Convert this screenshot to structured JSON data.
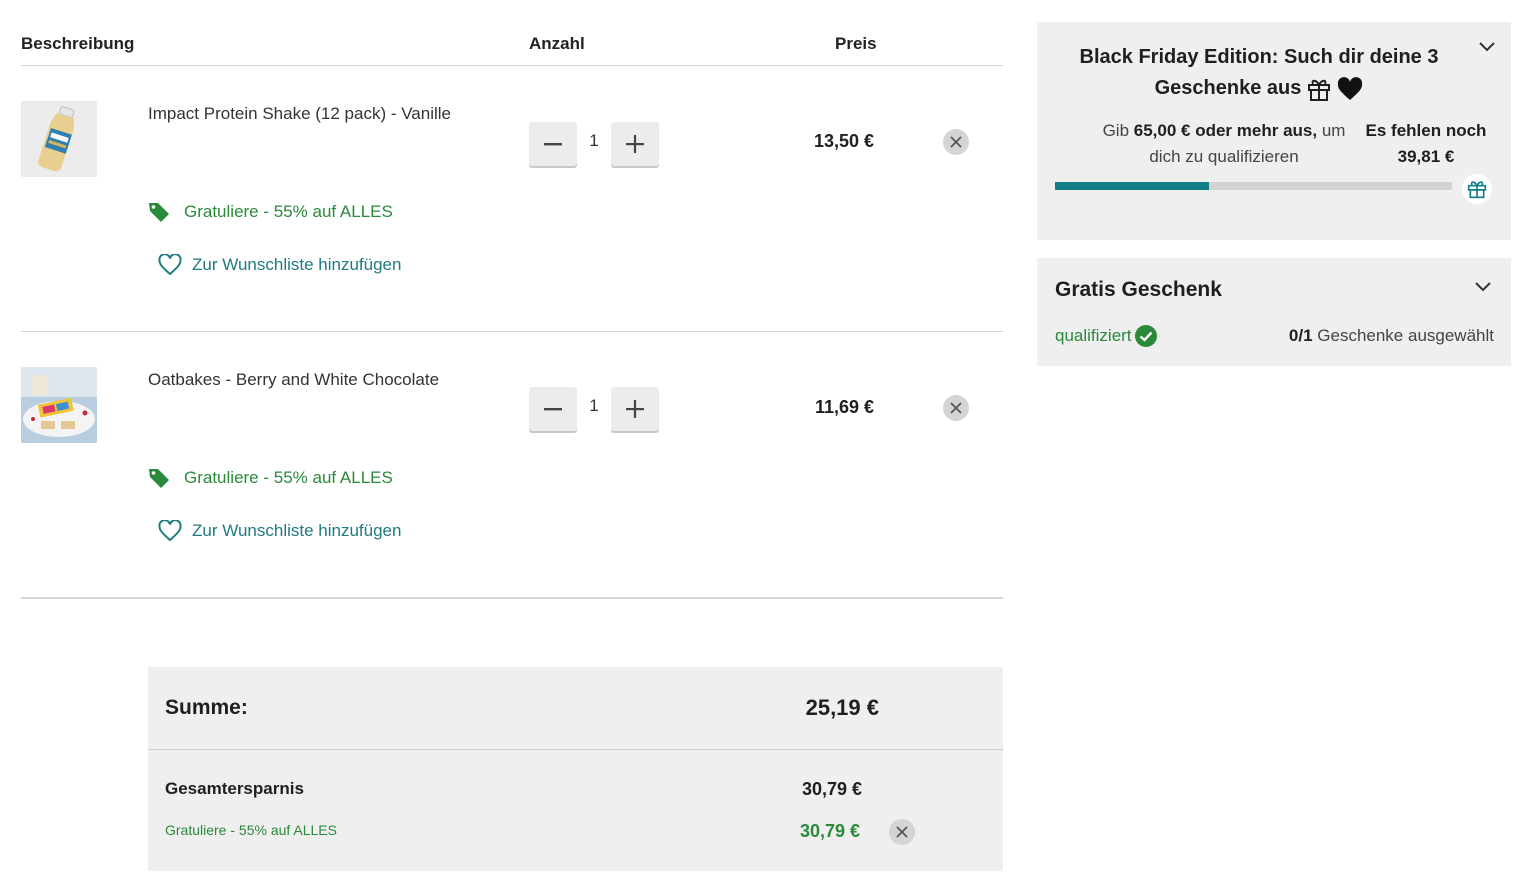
{
  "table": {
    "headers": {
      "description": "Beschreibung",
      "quantity": "Anzahl",
      "price": "Preis"
    }
  },
  "items": [
    {
      "name": "Impact Protein Shake (12 pack) - Vanille",
      "quantity": "1",
      "price": "13,50 €",
      "promo": "Gratuliere - 55% auf ALLES",
      "wishlist": "Zur Wunschliste hinzufügen"
    },
    {
      "name": "Oatbakes - Berry and White Chocolate",
      "quantity": "1",
      "price": "11,69 €",
      "promo": "Gratuliere - 55% auf ALLES",
      "wishlist": "Zur Wunschliste hinzufügen"
    }
  ],
  "summary": {
    "total_label": "Summe:",
    "total_value": "25,19 €",
    "savings_label": "Gesamtersparnis",
    "savings_value": "30,79 €",
    "promo_label": "Gratuliere - 55% auf ALLES",
    "promo_value": "30,79 €"
  },
  "black_friday": {
    "title_line1": "Black Friday Edition: Such dir deine 3",
    "title_line2": "Geschenke aus",
    "desc_pre": "Gib ",
    "desc_amount": "65,00 €",
    "desc_bold": " oder mehr aus,",
    "desc_post": " um",
    "desc_line2": "dich zu qualifizieren",
    "remaining_label": "Es fehlen noch",
    "remaining_value": "39,81 €",
    "progress_fraction": 0.387
  },
  "gift": {
    "title": "Gratis Geschenk",
    "status": "qualifiziert",
    "count": "0/1",
    "count_suffix": " Geschenke ausgewählt"
  },
  "colors": {
    "accent_teal": "#127f86",
    "promo_green": "#2a8a3a",
    "panel_bg": "#efefef"
  }
}
